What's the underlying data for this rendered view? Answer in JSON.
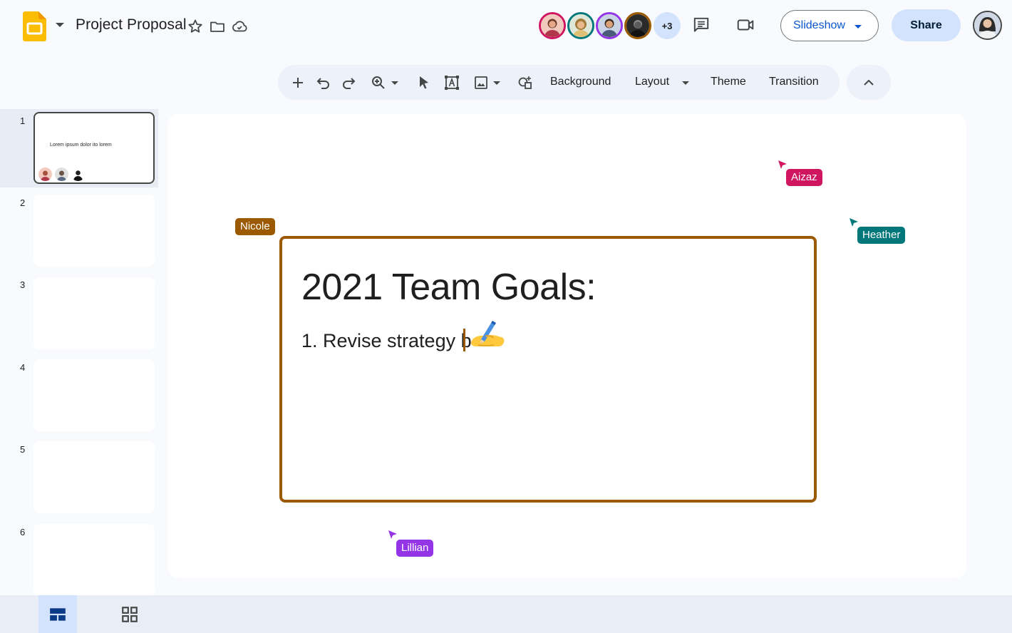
{
  "app": {
    "logo_icon": "google-slides-logo-icon",
    "title": "Project Proposal",
    "star_icon": "star-icon",
    "folder_icon": "move-folder-icon",
    "cloud_icon": "cloud-saved-icon"
  },
  "header": {
    "collaborators_overflow": "+3",
    "comments_icon": "comments-icon",
    "meet_icon": "video-camera-icon",
    "slideshow_label": "Slideshow",
    "share_label": "Share"
  },
  "toolbar": {
    "items": [
      "new-slide-icon",
      "undo-icon",
      "redo-icon",
      "zoom-icon",
      "select-icon",
      "text-box-icon",
      "image-icon",
      "shapes-icon"
    ],
    "background_label": "Background",
    "layout_label": "Layout",
    "theme_label": "Theme",
    "transition_label": "Transition",
    "collapse_icon": "chevron-up-icon"
  },
  "filmstrip": {
    "slides": [
      {
        "number": "1",
        "thumb_text": "Lorem ipsum dolor ito lorem"
      },
      {
        "number": "2"
      },
      {
        "number": "3"
      },
      {
        "number": "4"
      },
      {
        "number": "5"
      },
      {
        "number": "6"
      }
    ]
  },
  "slide": {
    "title": "2021 Team Goals:",
    "item_1": "1. Revise strategy b"
  },
  "cursors": [
    {
      "name": "Nicole",
      "color": "#9b5a00"
    },
    {
      "name": "Aizaz",
      "color": "#d01660"
    },
    {
      "name": "Heather",
      "color": "#00777a"
    },
    {
      "name": "Lillian",
      "color": "#9334e6"
    }
  ],
  "bottom": {
    "filmstrip_view_icon": "filmstrip-view-icon",
    "grid_view_icon": "grid-view-icon"
  },
  "colors": {
    "accent": "#0b57d0",
    "share_bg": "#d3e3fd",
    "toolbar_bg": "#edf2fa"
  }
}
